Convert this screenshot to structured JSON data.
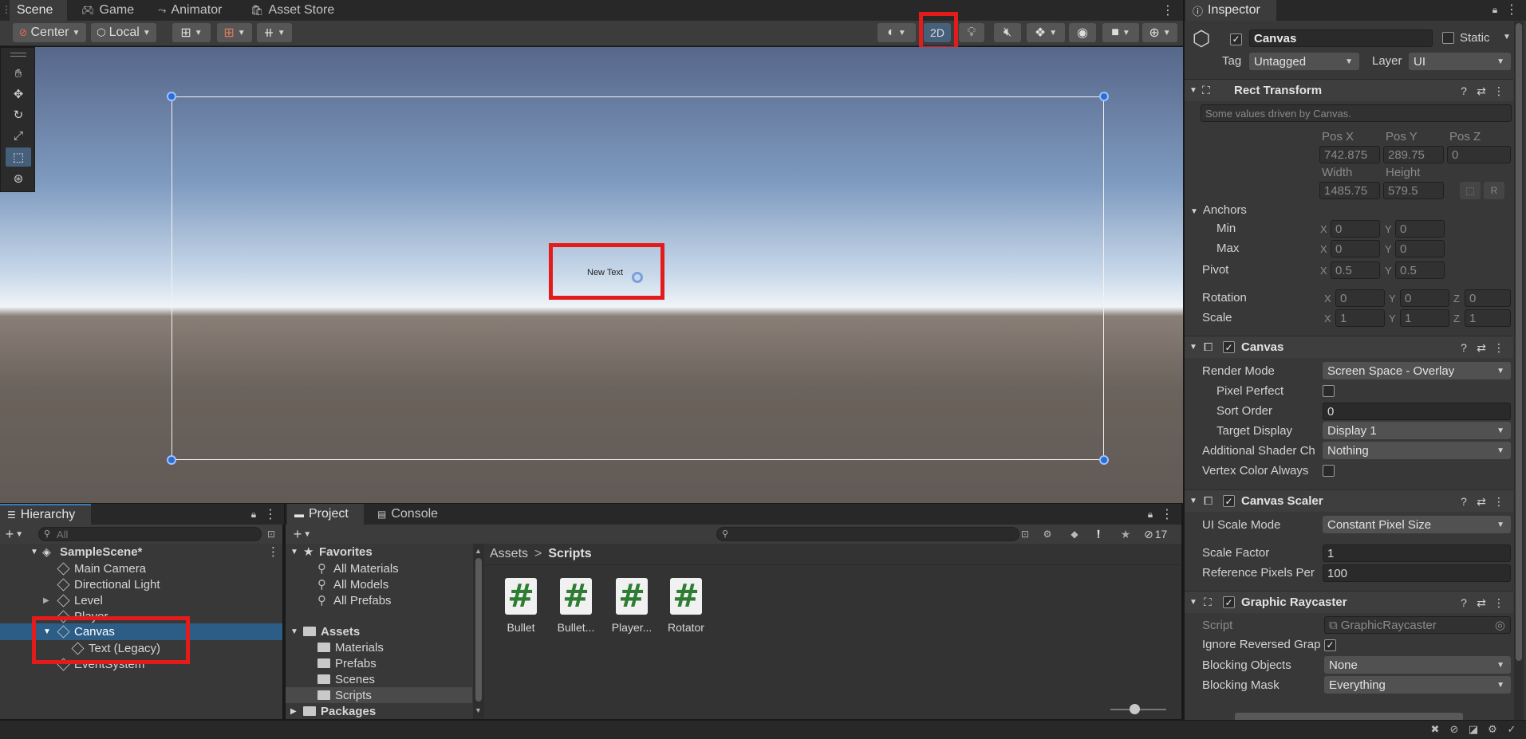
{
  "tabs": {
    "scene": "Scene",
    "game": "Game",
    "animator": "Animator",
    "asset_store": "Asset Store"
  },
  "scene_toolbar": {
    "pivot_mode": "Center",
    "pivot_rotation": "Local",
    "mode_2d": "2D"
  },
  "scene_view": {
    "canvas_text": "New Text"
  },
  "inspector": {
    "tab": "Inspector",
    "object_name": "Canvas",
    "static_label": "Static",
    "tag_label": "Tag",
    "tag_value": "Untagged",
    "layer_label": "Layer",
    "layer_value": "UI",
    "rect_transform": {
      "title": "Rect Transform",
      "note": "Some values driven by Canvas.",
      "pos_x_label": "Pos X",
      "pos_y_label": "Pos Y",
      "pos_z_label": "Pos Z",
      "pos_x": "742.875",
      "pos_y": "289.75",
      "pos_z": "0",
      "width_label": "Width",
      "height_label": "Height",
      "width": "1485.75",
      "height": "579.5",
      "anchors_label": "Anchors",
      "min_label": "Min",
      "max_label": "Max",
      "x_label": "X",
      "y_label": "Y",
      "z_label": "Z",
      "min_x": "0",
      "min_y": "0",
      "max_x": "0",
      "max_y": "0",
      "pivot_label": "Pivot",
      "pivot_x": "0.5",
      "pivot_y": "0.5",
      "rotation_label": "Rotation",
      "rot_x": "0",
      "rot_y": "0",
      "rot_z": "0",
      "scale_label": "Scale",
      "scale_x": "1",
      "scale_y": "1",
      "scale_z": "1"
    },
    "canvas": {
      "title": "Canvas",
      "render_mode_label": "Render Mode",
      "render_mode": "Screen Space - Overlay",
      "pixel_perfect_label": "Pixel Perfect",
      "sort_order_label": "Sort Order",
      "sort_order": "0",
      "target_display_label": "Target Display",
      "target_display": "Display 1",
      "additional_shader_label": "Additional Shader Ch",
      "additional_shader": "Nothing",
      "vertex_color_label": "Vertex Color Always"
    },
    "canvas_scaler": {
      "title": "Canvas Scaler",
      "ui_scale_mode_label": "UI Scale Mode",
      "ui_scale_mode": "Constant Pixel Size",
      "scale_factor_label": "Scale Factor",
      "scale_factor": "1",
      "ref_pixels_label": "Reference Pixels Per",
      "ref_pixels": "100"
    },
    "graphic_raycaster": {
      "title": "Graphic Raycaster",
      "script_label": "Script",
      "script": "GraphicRaycaster",
      "ignore_reversed_label": "Ignore Reversed Grap",
      "blocking_objects_label": "Blocking Objects",
      "blocking_objects": "None",
      "blocking_mask_label": "Blocking Mask",
      "blocking_mask": "Everything"
    }
  },
  "hierarchy": {
    "tab": "Hierarchy",
    "search_placeholder": "All",
    "scene": "SampleScene*",
    "items": [
      "Main Camera",
      "Directional Light",
      "Level",
      "Player",
      "Canvas",
      "Text (Legacy)",
      "EventSystem"
    ]
  },
  "project": {
    "tab": "Project",
    "console_tab": "Console",
    "hidden_count": "17",
    "favorites": "Favorites",
    "fav_items": [
      "All Materials",
      "All Models",
      "All Prefabs"
    ],
    "assets": "Assets",
    "asset_folders": [
      "Materials",
      "Prefabs",
      "Scenes",
      "Scripts"
    ],
    "packages": "Packages",
    "breadcrumb_root": "Assets",
    "breadcrumb_current": "Scripts",
    "files": [
      "Bullet",
      "Bullet...",
      "Player...",
      "Rotator"
    ],
    "file_icon": "#"
  },
  "colors": {
    "highlight": "#e41b1b",
    "selection": "#2c5d87",
    "accent": "#3a79bb"
  }
}
